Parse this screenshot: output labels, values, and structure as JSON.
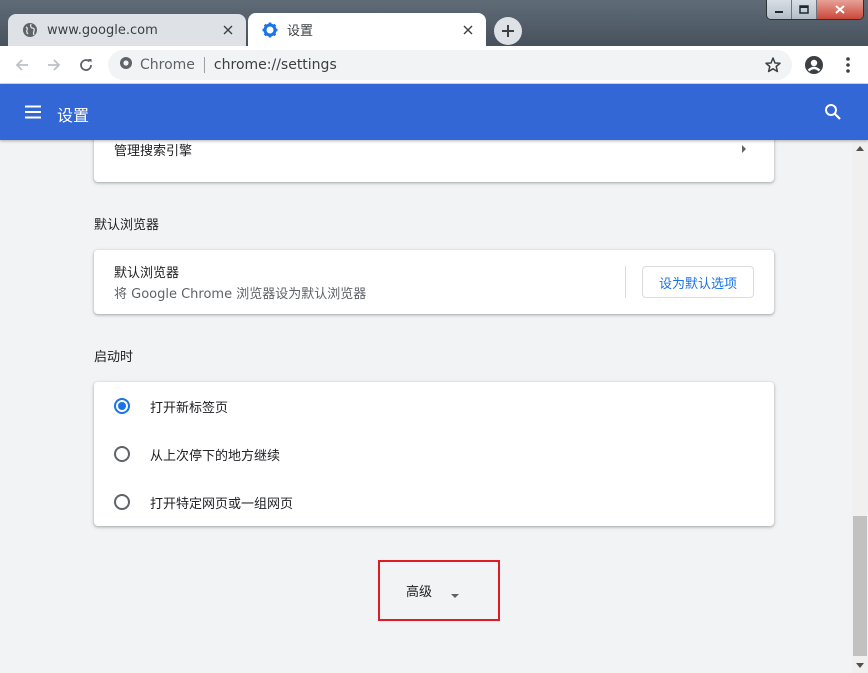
{
  "tabs": [
    {
      "title": "www.google.com",
      "icon": "globe-icon",
      "active": false
    },
    {
      "title": "设置",
      "icon": "gear-icon",
      "active": true
    }
  ],
  "toolbar": {
    "omnibox_chip": "Chrome",
    "url": "chrome://settings"
  },
  "header": {
    "title": "设置"
  },
  "search_engine": {
    "manage_label": "管理搜索引擎"
  },
  "default_browser": {
    "section_title": "默认浏览器",
    "label": "默认浏览器",
    "sublabel": "将 Google Chrome 浏览器设为默认浏览器",
    "button_label": "设为默认选项"
  },
  "startup": {
    "section_title": "启动时",
    "options": [
      {
        "label": "打开新标签页",
        "checked": true
      },
      {
        "label": "从上次停下的地方继续",
        "checked": false
      },
      {
        "label": "打开特定网页或一组网页",
        "checked": false
      }
    ]
  },
  "advanced": {
    "label": "高级"
  },
  "colors": {
    "header_bg": "#3367d6",
    "accent": "#1a73e8",
    "highlight_box": "#e01b24"
  }
}
